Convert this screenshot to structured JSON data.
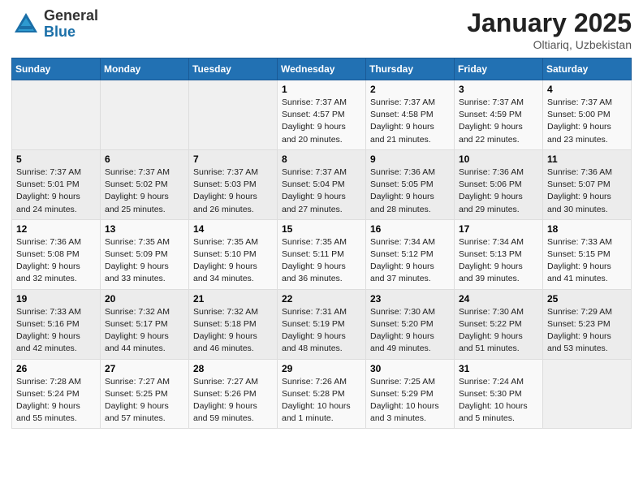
{
  "header": {
    "logo_general": "General",
    "logo_blue": "Blue",
    "title": "January 2025",
    "location": "Oltiariq, Uzbekistan"
  },
  "weekdays": [
    "Sunday",
    "Monday",
    "Tuesday",
    "Wednesday",
    "Thursday",
    "Friday",
    "Saturday"
  ],
  "weeks": [
    [
      {
        "day": "",
        "info": ""
      },
      {
        "day": "",
        "info": ""
      },
      {
        "day": "",
        "info": ""
      },
      {
        "day": "1",
        "info": "Sunrise: 7:37 AM\nSunset: 4:57 PM\nDaylight: 9 hours\nand 20 minutes."
      },
      {
        "day": "2",
        "info": "Sunrise: 7:37 AM\nSunset: 4:58 PM\nDaylight: 9 hours\nand 21 minutes."
      },
      {
        "day": "3",
        "info": "Sunrise: 7:37 AM\nSunset: 4:59 PM\nDaylight: 9 hours\nand 22 minutes."
      },
      {
        "day": "4",
        "info": "Sunrise: 7:37 AM\nSunset: 5:00 PM\nDaylight: 9 hours\nand 23 minutes."
      }
    ],
    [
      {
        "day": "5",
        "info": "Sunrise: 7:37 AM\nSunset: 5:01 PM\nDaylight: 9 hours\nand 24 minutes."
      },
      {
        "day": "6",
        "info": "Sunrise: 7:37 AM\nSunset: 5:02 PM\nDaylight: 9 hours\nand 25 minutes."
      },
      {
        "day": "7",
        "info": "Sunrise: 7:37 AM\nSunset: 5:03 PM\nDaylight: 9 hours\nand 26 minutes."
      },
      {
        "day": "8",
        "info": "Sunrise: 7:37 AM\nSunset: 5:04 PM\nDaylight: 9 hours\nand 27 minutes."
      },
      {
        "day": "9",
        "info": "Sunrise: 7:36 AM\nSunset: 5:05 PM\nDaylight: 9 hours\nand 28 minutes."
      },
      {
        "day": "10",
        "info": "Sunrise: 7:36 AM\nSunset: 5:06 PM\nDaylight: 9 hours\nand 29 minutes."
      },
      {
        "day": "11",
        "info": "Sunrise: 7:36 AM\nSunset: 5:07 PM\nDaylight: 9 hours\nand 30 minutes."
      }
    ],
    [
      {
        "day": "12",
        "info": "Sunrise: 7:36 AM\nSunset: 5:08 PM\nDaylight: 9 hours\nand 32 minutes."
      },
      {
        "day": "13",
        "info": "Sunrise: 7:35 AM\nSunset: 5:09 PM\nDaylight: 9 hours\nand 33 minutes."
      },
      {
        "day": "14",
        "info": "Sunrise: 7:35 AM\nSunset: 5:10 PM\nDaylight: 9 hours\nand 34 minutes."
      },
      {
        "day": "15",
        "info": "Sunrise: 7:35 AM\nSunset: 5:11 PM\nDaylight: 9 hours\nand 36 minutes."
      },
      {
        "day": "16",
        "info": "Sunrise: 7:34 AM\nSunset: 5:12 PM\nDaylight: 9 hours\nand 37 minutes."
      },
      {
        "day": "17",
        "info": "Sunrise: 7:34 AM\nSunset: 5:13 PM\nDaylight: 9 hours\nand 39 minutes."
      },
      {
        "day": "18",
        "info": "Sunrise: 7:33 AM\nSunset: 5:15 PM\nDaylight: 9 hours\nand 41 minutes."
      }
    ],
    [
      {
        "day": "19",
        "info": "Sunrise: 7:33 AM\nSunset: 5:16 PM\nDaylight: 9 hours\nand 42 minutes."
      },
      {
        "day": "20",
        "info": "Sunrise: 7:32 AM\nSunset: 5:17 PM\nDaylight: 9 hours\nand 44 minutes."
      },
      {
        "day": "21",
        "info": "Sunrise: 7:32 AM\nSunset: 5:18 PM\nDaylight: 9 hours\nand 46 minutes."
      },
      {
        "day": "22",
        "info": "Sunrise: 7:31 AM\nSunset: 5:19 PM\nDaylight: 9 hours\nand 48 minutes."
      },
      {
        "day": "23",
        "info": "Sunrise: 7:30 AM\nSunset: 5:20 PM\nDaylight: 9 hours\nand 49 minutes."
      },
      {
        "day": "24",
        "info": "Sunrise: 7:30 AM\nSunset: 5:22 PM\nDaylight: 9 hours\nand 51 minutes."
      },
      {
        "day": "25",
        "info": "Sunrise: 7:29 AM\nSunset: 5:23 PM\nDaylight: 9 hours\nand 53 minutes."
      }
    ],
    [
      {
        "day": "26",
        "info": "Sunrise: 7:28 AM\nSunset: 5:24 PM\nDaylight: 9 hours\nand 55 minutes."
      },
      {
        "day": "27",
        "info": "Sunrise: 7:27 AM\nSunset: 5:25 PM\nDaylight: 9 hours\nand 57 minutes."
      },
      {
        "day": "28",
        "info": "Sunrise: 7:27 AM\nSunset: 5:26 PM\nDaylight: 9 hours\nand 59 minutes."
      },
      {
        "day": "29",
        "info": "Sunrise: 7:26 AM\nSunset: 5:28 PM\nDaylight: 10 hours\nand 1 minute."
      },
      {
        "day": "30",
        "info": "Sunrise: 7:25 AM\nSunset: 5:29 PM\nDaylight: 10 hours\nand 3 minutes."
      },
      {
        "day": "31",
        "info": "Sunrise: 7:24 AM\nSunset: 5:30 PM\nDaylight: 10 hours\nand 5 minutes."
      },
      {
        "day": "",
        "info": ""
      }
    ]
  ]
}
